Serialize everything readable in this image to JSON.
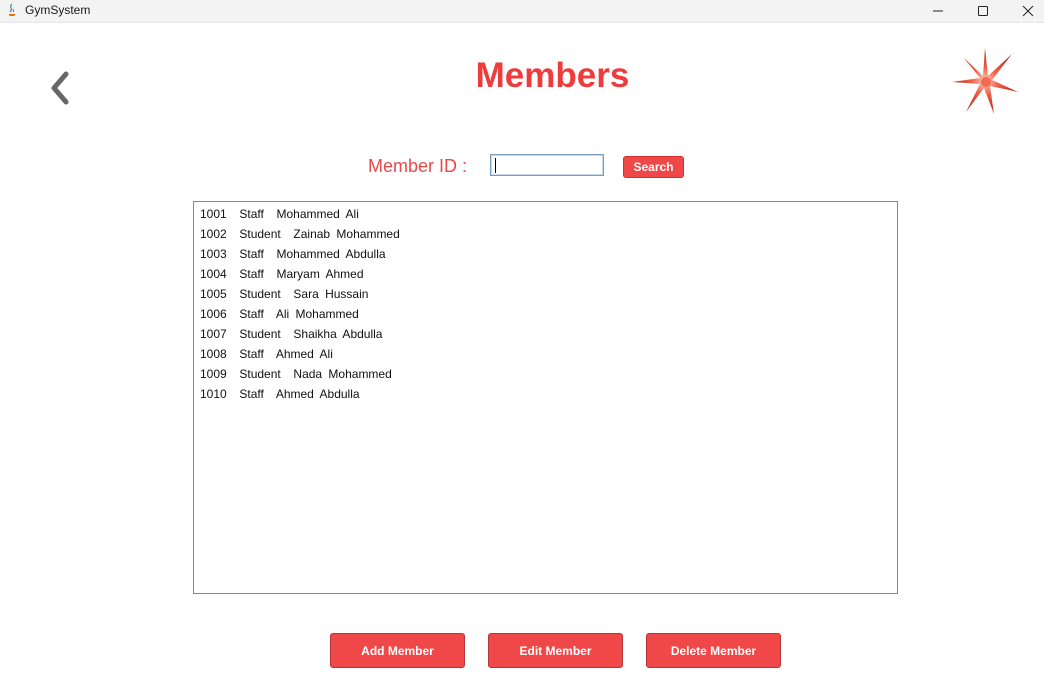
{
  "window": {
    "title": "GymSystem"
  },
  "header": {
    "title": "Members"
  },
  "search": {
    "label": "Member ID :",
    "value": "",
    "button_label": "Search"
  },
  "members": [
    {
      "text": "1001  Staff  Mohammed Ali"
    },
    {
      "text": "1002  Student  Zainab Mohammed"
    },
    {
      "text": "1003  Staff  Mohammed Abdulla"
    },
    {
      "text": "1004  Staff  Maryam Ahmed"
    },
    {
      "text": "1005  Student  Sara Hussain"
    },
    {
      "text": "1006  Staff  Ali Mohammed"
    },
    {
      "text": "1007  Student  Shaikha Abdulla"
    },
    {
      "text": "1008  Staff  Ahmed Ali"
    },
    {
      "text": "1009  Student  Nada Mohammed"
    },
    {
      "text": "1010  Staff  Ahmed Abdulla"
    }
  ],
  "actions": {
    "add_label": "Add Member",
    "edit_label": "Edit Member",
    "delete_label": "Delete Member"
  },
  "colors": {
    "accent": "#ee3b3b",
    "button": "#f04848"
  },
  "icons": {
    "back": "chevron-left-icon",
    "logo": "star-burst-logo"
  }
}
